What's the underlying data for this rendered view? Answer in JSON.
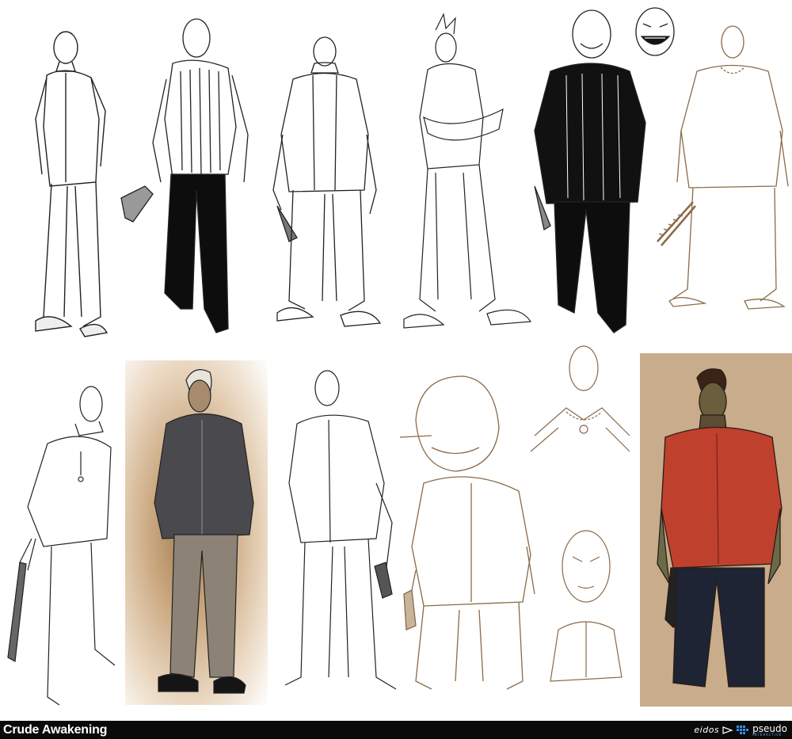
{
  "footer": {
    "title": "Crude Awakening",
    "publisher_logo_text": "eidos",
    "studio_logo_text": "pseudo",
    "studio_logo_subtext": "INTERACTIVE"
  },
  "colors": {
    "background": "#ffffff",
    "footer": "#0a0a0a",
    "accent_panel": "#c8ac8c",
    "sepia_line": "#8a6a48",
    "red_shirt": "#c0402e"
  }
}
